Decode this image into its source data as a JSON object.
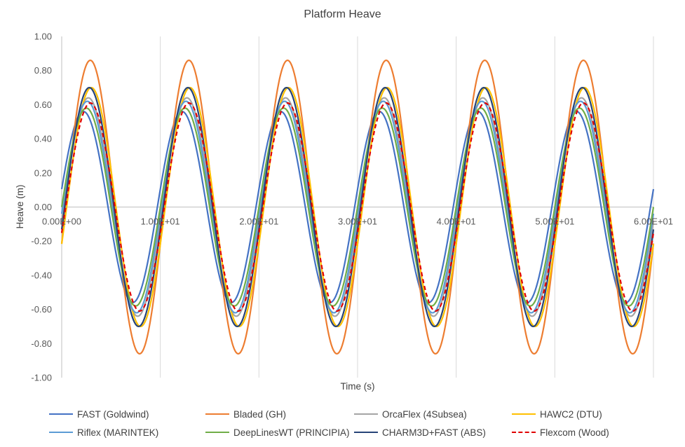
{
  "chart_data": {
    "type": "line",
    "title": "Platform Heave",
    "xlabel": "Time (s)",
    "ylabel": "Heave (m)",
    "xlim": [
      0,
      60
    ],
    "ylim": [
      -1.0,
      1.0
    ],
    "x_ticks": [
      0,
      10,
      20,
      30,
      40,
      50,
      60
    ],
    "x_tick_labels": [
      "0.00E+00",
      "1.00E+01",
      "2.00E+01",
      "3.00E+01",
      "4.00E+01",
      "5.00E+01",
      "6.00E+01"
    ],
    "y_ticks": [
      -1.0,
      -0.8,
      -0.6,
      -0.4,
      -0.2,
      0.0,
      0.2,
      0.4,
      0.6,
      0.8,
      1.0
    ],
    "y_tick_labels": [
      "-1.00",
      "-0.80",
      "-0.60",
      "-0.40",
      "-0.20",
      "0.00",
      "0.20",
      "0.40",
      "0.60",
      "0.80",
      "1.00"
    ],
    "grid": "vertical",
    "legend_position": "bottom",
    "period": 10,
    "series": [
      {
        "name": "FAST (Goldwind)",
        "color": "#4472C4",
        "amplitude": 0.56,
        "first_peak_x": 2.2,
        "dashed": false
      },
      {
        "name": "Bladed (GH)",
        "color": "#ED7D31",
        "amplitude": 0.86,
        "first_peak_x": 2.9,
        "dashed": false
      },
      {
        "name": "OrcaFlex (4Subsea)",
        "color": "#A5A5A5",
        "amplitude": 0.64,
        "first_peak_x": 2.7,
        "dashed": false
      },
      {
        "name": "HAWC2 (DTU)",
        "color": "#FFC000",
        "amplitude": 0.7,
        "first_peak_x": 3.0,
        "dashed": false
      },
      {
        "name": "Riflex (MARINTEK)",
        "color": "#5B9BD5",
        "amplitude": 0.62,
        "first_peak_x": 2.6,
        "dashed": false
      },
      {
        "name": "DeepLinesWT (PRINCIPIA)",
        "color": "#70AD47",
        "amplitude": 0.58,
        "first_peak_x": 2.5,
        "dashed": false
      },
      {
        "name": "CHARM3D+FAST (ABS)",
        "color": "#264478",
        "amplitude": 0.7,
        "first_peak_x": 2.8,
        "dashed": false
      },
      {
        "name": "Flexcom (Wood)",
        "color": "#E00000",
        "amplitude": 0.61,
        "first_peak_x": 2.9,
        "dashed": true
      }
    ]
  }
}
